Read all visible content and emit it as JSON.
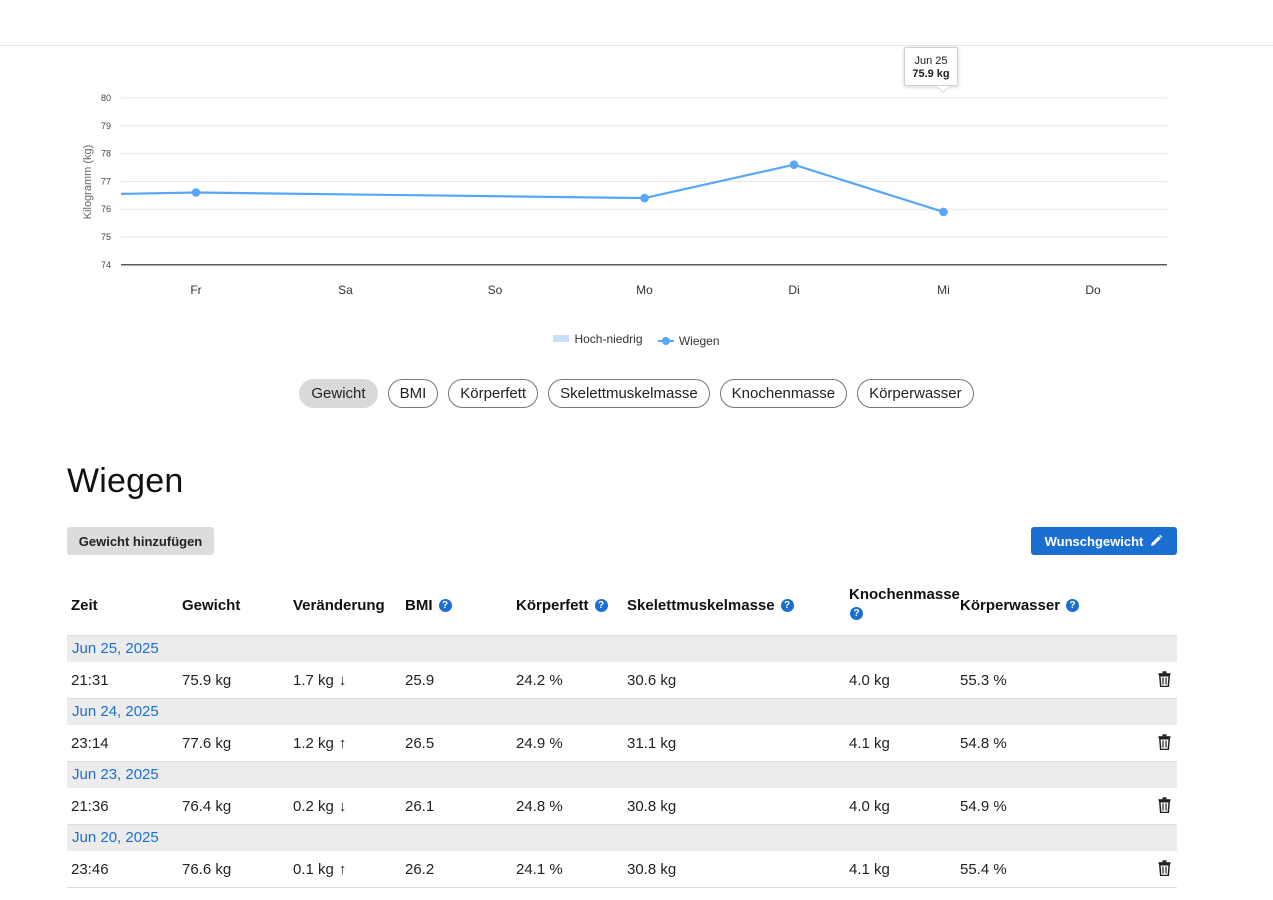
{
  "chart_data": {
    "type": "line",
    "ylabel": "Kilogramm (kg)",
    "ylim": [
      74,
      80
    ],
    "yticks": [
      "80",
      "79",
      "78",
      "77",
      "76",
      "75",
      "74"
    ],
    "categories": [
      "Fr",
      "Sa",
      "So",
      "Mo",
      "Di",
      "Mi",
      "Do"
    ],
    "series": [
      {
        "name": "Wiegen",
        "color": "#57a6f7",
        "points": [
          {
            "category": "Fr",
            "value": 76.6
          },
          {
            "category": "Mo",
            "value": 76.4
          },
          {
            "category": "Di",
            "value": 77.6
          },
          {
            "category": "Mi",
            "value": 75.9
          }
        ],
        "line_start_value": 76.55
      }
    ],
    "tooltip": {
      "category": "Mi",
      "date": "Jun 25",
      "value": "75.9 kg"
    },
    "legend": [
      {
        "label": "Hoch-niedrig",
        "symbol": "band",
        "color": "#c8defa"
      },
      {
        "label": "Wiegen",
        "symbol": "line-marker",
        "color": "#57a6f7"
      }
    ],
    "legend_position": "bottom-center",
    "grid": true
  },
  "metric_tabs": [
    "Gewicht",
    "BMI",
    "Körperfett",
    "Skelettmuskelmasse",
    "Knochenmasse",
    "Körperwasser"
  ],
  "active_tab": "Gewicht",
  "section": {
    "title": "Wiegen",
    "add_button": "Gewicht hinzufügen",
    "goal_button": "Wunschgewicht"
  },
  "table": {
    "headers": {
      "zeit": "Zeit",
      "gewicht": "Gewicht",
      "veraenderung": "Veränderung",
      "bmi": "BMI",
      "koerperfett": "Körperfett",
      "skelettmuskelmasse": "Skelettmuskelmasse",
      "knochenmasse": "Knochenmasse",
      "koerperwasser": "Körperwasser"
    },
    "entries": [
      {
        "date": "Jun 25, 2025",
        "time": "21:31",
        "weight": "75.9 kg",
        "change": "1.7 kg",
        "arrow": "↓",
        "bmi": "25.9",
        "fat": "24.2 %",
        "muscle": "30.6 kg",
        "bone": "4.0 kg",
        "water": "55.3 %"
      },
      {
        "date": "Jun 24, 2025",
        "time": "23:14",
        "weight": "77.6 kg",
        "change": "1.2 kg",
        "arrow": "↑",
        "bmi": "26.5",
        "fat": "24.9 %",
        "muscle": "31.1 kg",
        "bone": "4.1 kg",
        "water": "54.8 %"
      },
      {
        "date": "Jun 23, 2025",
        "time": "21:36",
        "weight": "76.4 kg",
        "change": "0.2 kg",
        "arrow": "↓",
        "bmi": "26.1",
        "fat": "24.8 %",
        "muscle": "30.8 kg",
        "bone": "4.0 kg",
        "water": "54.9 %"
      },
      {
        "date": "Jun 20, 2025",
        "time": "23:46",
        "weight": "76.6 kg",
        "change": "0.1 kg",
        "arrow": "↑",
        "bmi": "26.2",
        "fat": "24.1 %",
        "muscle": "30.8 kg",
        "bone": "4.1 kg",
        "water": "55.4 %"
      }
    ]
  },
  "icons": {
    "help": "question-circle-icon",
    "delete": "trash-icon",
    "edit": "pencil-icon"
  }
}
